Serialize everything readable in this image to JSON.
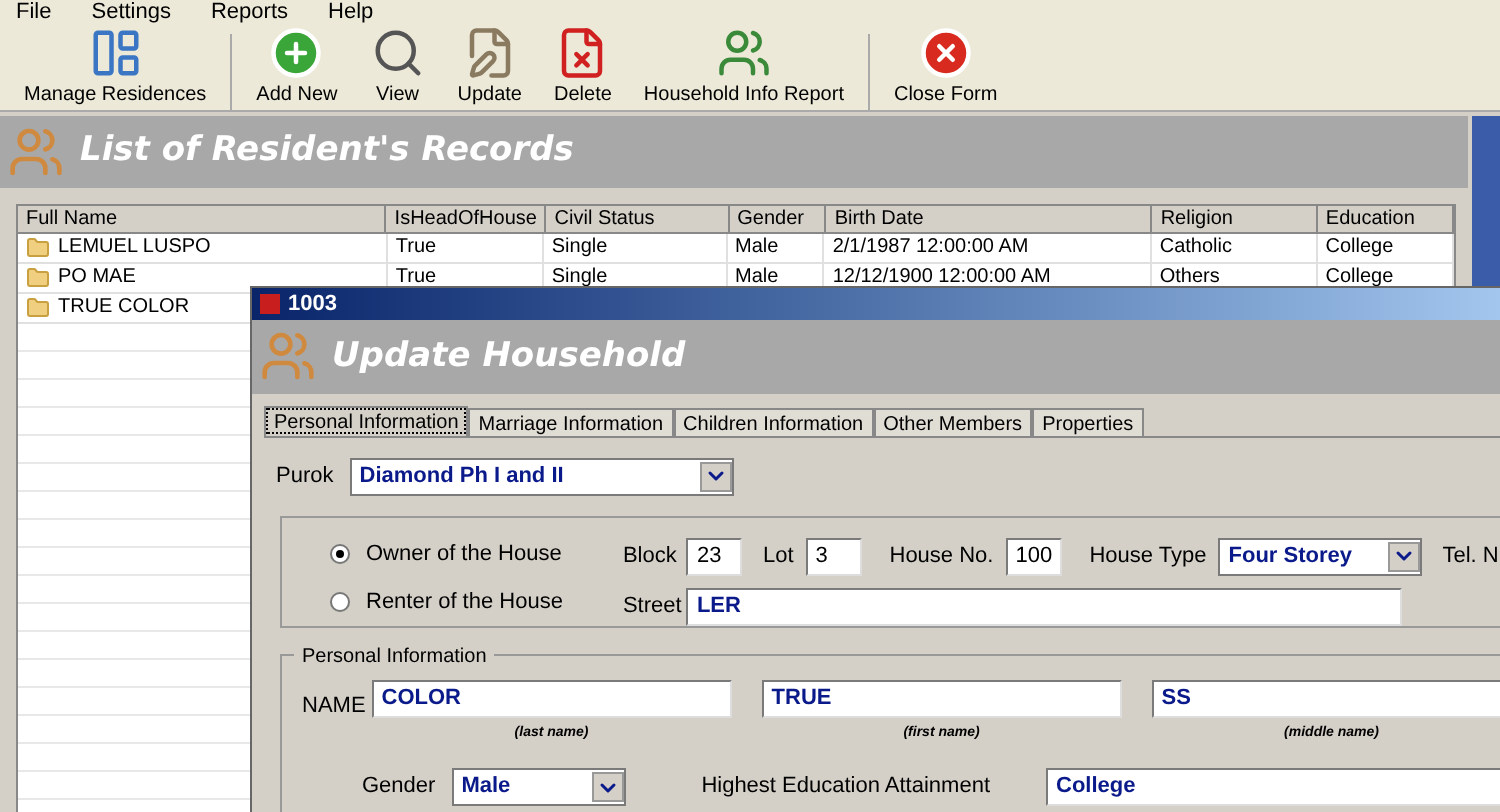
{
  "menu": [
    "File",
    "Settings",
    "Reports",
    "Help"
  ],
  "toolbar": [
    "Manage Residences",
    "Add New",
    "View",
    "Update",
    "Delete",
    "Household Info Report",
    "Close Form"
  ],
  "header": {
    "title": "List of Resident's Records"
  },
  "table": {
    "columns": [
      "Full Name",
      "IsHeadOfHouse",
      "Civil Status",
      "Gender",
      "Birth Date",
      "Religion",
      "Education"
    ],
    "rows": [
      [
        "LEMUEL LUSPO",
        "True",
        "Single",
        "Male",
        "2/1/1987 12:00:00 AM",
        "Catholic",
        "College"
      ],
      [
        "PO MAE",
        "True",
        "Single",
        "Male",
        "12/12/1900 12:00:00 AM",
        "Others",
        "College"
      ],
      [
        "TRUE COLOR"
      ]
    ]
  },
  "dialog": {
    "title": "1003",
    "header": "Update Household",
    "tabs": [
      {
        "label": "Personal Information",
        "selected": true
      },
      {
        "label": "Marriage Information",
        "selected": false
      },
      {
        "label": "Children Information",
        "selected": false
      },
      {
        "label": "Other Members",
        "selected": false
      },
      {
        "label": "Properties",
        "selected": false
      }
    ],
    "purok": {
      "label": "Purok",
      "value": "Diamond Ph I and II"
    },
    "ownership": [
      {
        "label": "Owner of the House",
        "selected": true
      },
      {
        "label": "Renter of the House",
        "selected": false
      }
    ],
    "block": {
      "label": "Block",
      "value": "23"
    },
    "lot": {
      "label": "Lot",
      "value": "3"
    },
    "house_no": {
      "label": "House No.",
      "value": "100"
    },
    "house_type": {
      "label": "House Type",
      "value": "Four Storey"
    },
    "tel_label": "Tel. N",
    "street": {
      "label": "Street",
      "value": "LER"
    },
    "personal": {
      "legend": "Personal Information",
      "name_label": "NAME",
      "names": [
        {
          "value": "COLOR",
          "caption": "(last name)"
        },
        {
          "value": "TRUE",
          "caption": "(first name)"
        },
        {
          "value": "SS",
          "caption": "(middle name)"
        }
      ],
      "gender": {
        "label": "Gender",
        "value": "Male"
      },
      "education": {
        "label": "Highest Education Attainment",
        "value": "College"
      }
    }
  }
}
